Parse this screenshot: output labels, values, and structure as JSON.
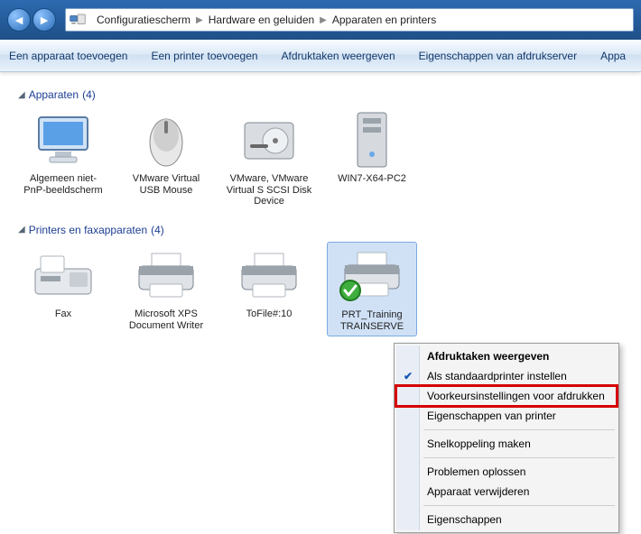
{
  "breadcrumb": {
    "items": [
      "Configuratiescherm",
      "Hardware en geluiden",
      "Apparaten en printers"
    ]
  },
  "toolbar": {
    "add_device": "Een apparaat toevoegen",
    "add_printer": "Een printer toevoegen",
    "view_jobs": "Afdruktaken weergeven",
    "server_props": "Eigenschappen van afdrukserver",
    "remove_device": "Appa"
  },
  "section_devices": {
    "title": "Apparaten",
    "count": "(4)"
  },
  "devices": [
    {
      "label": "Algemeen niet-PnP-beeldscherm",
      "icon": "monitor"
    },
    {
      "label": "VMware Virtual USB Mouse",
      "icon": "mouse"
    },
    {
      "label": "VMware, VMware Virtual S SCSI Disk Device",
      "icon": "disk"
    },
    {
      "label": "WIN7-X64-PC2",
      "icon": "tower"
    }
  ],
  "section_printers": {
    "title": "Printers en faxapparaten",
    "count": "(4)"
  },
  "printers": [
    {
      "label": "Fax",
      "icon": "fax"
    },
    {
      "label": "Microsoft XPS Document Writer",
      "icon": "printer"
    },
    {
      "label": "ToFile#:10",
      "icon": "printer"
    },
    {
      "label": "PRT_Training TRAINSERVE",
      "icon": "printer-default",
      "selected": true
    }
  ],
  "ctx": {
    "view_jobs": "Afdruktaken weergeven",
    "set_default": "Als standaardprinter instellen",
    "printing_prefs": "Voorkeursinstellingen voor afdrukken",
    "printer_props": "Eigenschappen van printer",
    "shortcut": "Snelkoppeling maken",
    "troubleshoot": "Problemen oplossen",
    "remove": "Apparaat verwijderen",
    "properties": "Eigenschappen"
  }
}
